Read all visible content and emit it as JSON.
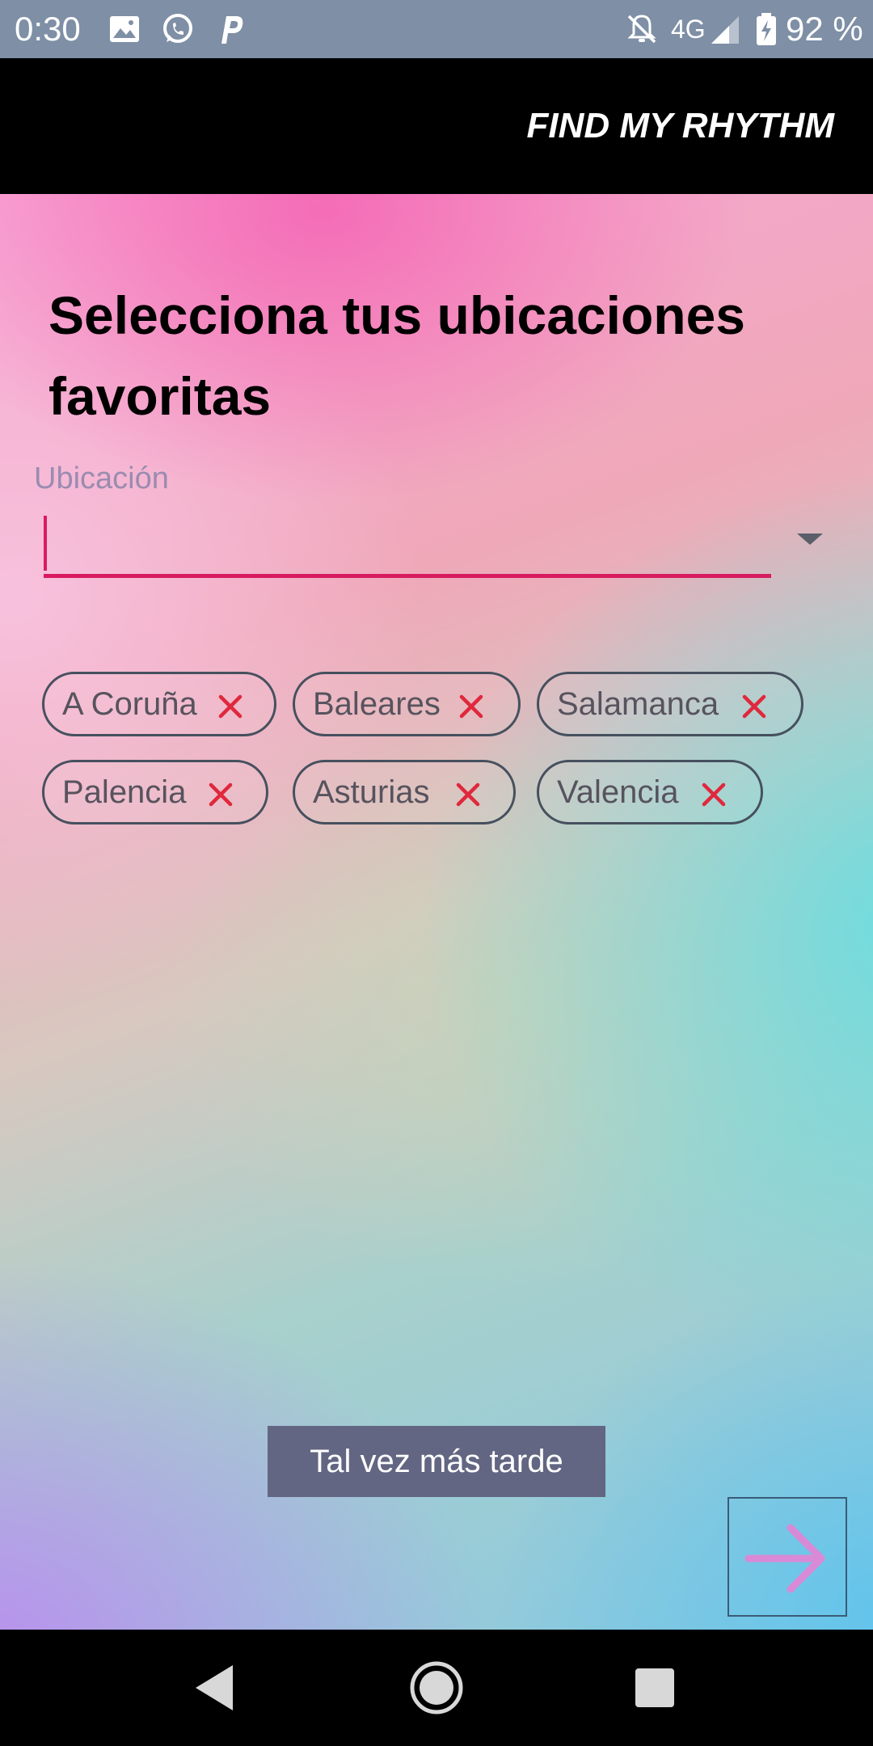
{
  "status_bar": {
    "time": "0:30",
    "network": "4G",
    "battery": "92 %",
    "icons": [
      "image-icon",
      "whatsapp-icon",
      "parking-icon",
      "notifications-off-icon",
      "signal-icon",
      "battery-charging-icon"
    ]
  },
  "app_bar": {
    "title": "FIND MY RHYTHM"
  },
  "main": {
    "heading": "Selecciona tus ubicaciones favoritas",
    "location_field": {
      "label": "Ubicación",
      "value": ""
    },
    "chips": [
      {
        "label": "A Coruña"
      },
      {
        "label": "Baleares"
      },
      {
        "label": "Salamanca"
      },
      {
        "label": "Palencia"
      },
      {
        "label": "Asturias"
      },
      {
        "label": "Valencia"
      }
    ],
    "later_button": "Tal vez más tarde",
    "next_icon": "arrow-right-icon"
  },
  "nav_bar": {
    "icons": [
      "back-icon",
      "home-icon",
      "recents-icon"
    ]
  },
  "colors": {
    "accent": "#d81b60",
    "chip_close": "#e0283c",
    "next_arrow": "#d98ad6",
    "app_bar": "#000000",
    "status_bar": "#7e8fa6"
  }
}
